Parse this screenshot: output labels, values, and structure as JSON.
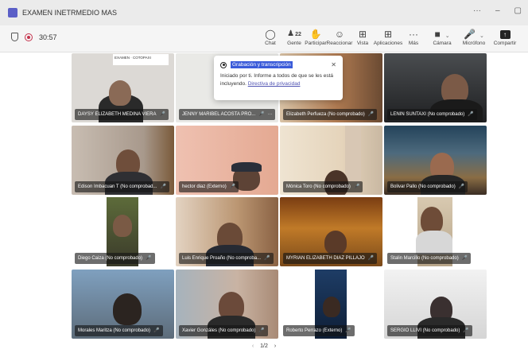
{
  "window": {
    "title": "EXAMEN INETRMEDIO MAS",
    "controls": [
      "···",
      "–",
      "▢"
    ]
  },
  "toolbar": {
    "timer": "30:57",
    "participants_count": "22",
    "items": [
      {
        "label": "Chat",
        "icon": "chat-icon"
      },
      {
        "label": "Gente",
        "icon": "people-icon"
      },
      {
        "label": "Participar",
        "icon": "raise-hand-icon"
      },
      {
        "label": "Reaccionar",
        "icon": "react-icon"
      },
      {
        "label": "Vista",
        "icon": "view-icon"
      },
      {
        "label": "Aplicaciones",
        "icon": "apps-icon"
      },
      {
        "label": "Más",
        "icon": "more-icon"
      },
      {
        "label": "Cámara",
        "icon": "camera-icon"
      },
      {
        "label": "Micrófono",
        "icon": "mic-off-icon"
      },
      {
        "label": "Compartir",
        "icon": "share-icon"
      }
    ]
  },
  "popup": {
    "title": "Grabación y transcripción",
    "body": "Iniciado por ti. Informe a todos de que se les está incluyendo.",
    "link": "Directiva de privacidad",
    "close": "✕"
  },
  "tiles": [
    {
      "name": "DAYSY ELIZABETH MEDINA VIERA",
      "bg": "#d9d6d2",
      "logo": "EXAMEN · COTOPAXI"
    },
    {
      "name": "JENNY MARIBEL ACOSTA PRO...",
      "bg": "#e7e7e4"
    },
    {
      "name": "Elizabeth Perfueza (No comprobado)",
      "bg": "#c9a37f"
    },
    {
      "name": "LENIN SUNTAXI (No comprobado)",
      "bg": "#2c2d2f"
    },
    {
      "name": "Edison Imbacuan T (No comprobad...",
      "bg": "#b0a294"
    },
    {
      "name": "hector diaz (Externo)",
      "bg": "#e6b3a3"
    },
    {
      "name": "Mónica Toro (No comprobado)",
      "bg": "#e9d8c2"
    },
    {
      "name": "Bolivar Pallo (No comprobado)",
      "bg": "#3d4b57"
    },
    {
      "name": "Diego Caiza (No comprobado)",
      "bg": "#ffffff"
    },
    {
      "name": "Luis Enrique Proaño (No comproba...",
      "bg": "#caa584"
    },
    {
      "name": "MYRIAN ELIZABETH DIAZ PILLAJO",
      "bg": "#9a5a20"
    },
    {
      "name": "Stalin Marcillo (No comprobado)",
      "bg": "#ffffff"
    },
    {
      "name": "Morales Maritza (No comprobado)",
      "bg": "#6f7c8a"
    },
    {
      "name": "Xavier Gonzáles (No comprobado)",
      "bg": "#b39b8c"
    },
    {
      "name": "Roberto Perrazo (Externo)",
      "bg": "#ffffff"
    },
    {
      "name": "SERGIO LLIVI (No comprobado)",
      "bg": "#e1e1e1"
    }
  ],
  "pager": {
    "prev": "‹",
    "label": "1/2",
    "next": "›"
  }
}
